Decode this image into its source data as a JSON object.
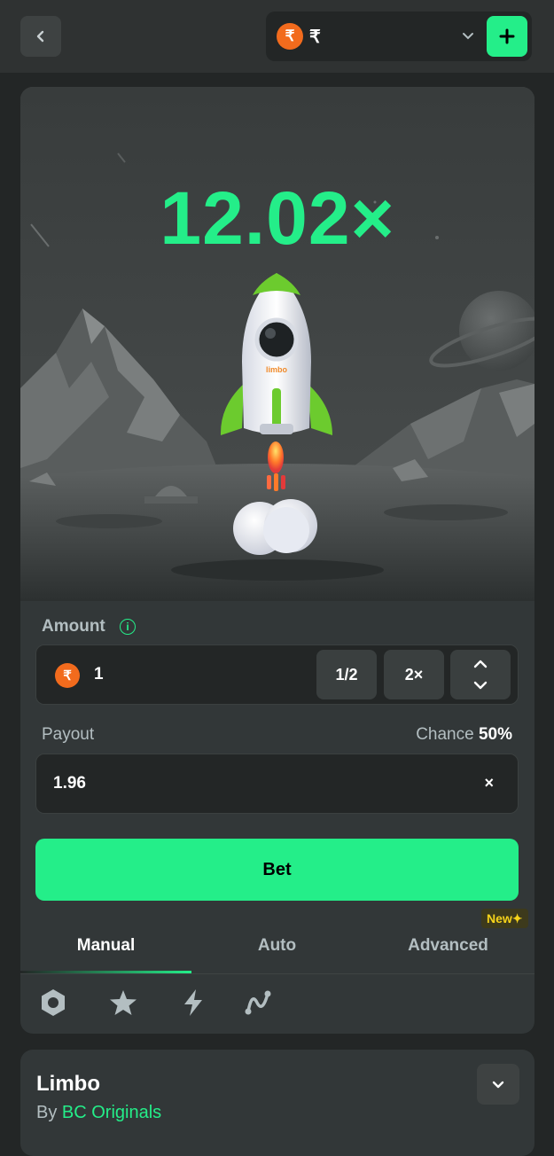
{
  "header": {
    "currency_symbol_coin": "₹",
    "currency_label": "₹"
  },
  "game": {
    "multiplier": "12.02×",
    "rocket_text": "limbo"
  },
  "bet_panel": {
    "amount_label": "Amount",
    "amount_info": "i",
    "amount_coin": "₹",
    "amount_value": "1",
    "half_label": "1/2",
    "double_label": "2×",
    "payout_label": "Payout",
    "chance_label": "Chance",
    "chance_value": "50%",
    "payout_value": "1.96",
    "payout_suffix": "×",
    "bet_label": "Bet"
  },
  "tabs": [
    {
      "label": "Manual",
      "active": true
    },
    {
      "label": "Auto",
      "active": false
    },
    {
      "label": "Advanced",
      "active": false
    }
  ],
  "new_badge": "New",
  "tool_icons": [
    "hexagon-icon",
    "star-icon",
    "lightning-icon",
    "graph-icon"
  ],
  "info_card": {
    "title": "Limbo",
    "by_prefix": "By",
    "by_link": "BC Originals"
  },
  "colors": {
    "accent": "#24ee89",
    "background": "#232626",
    "card": "#323738",
    "coin": "#f26b1d"
  }
}
